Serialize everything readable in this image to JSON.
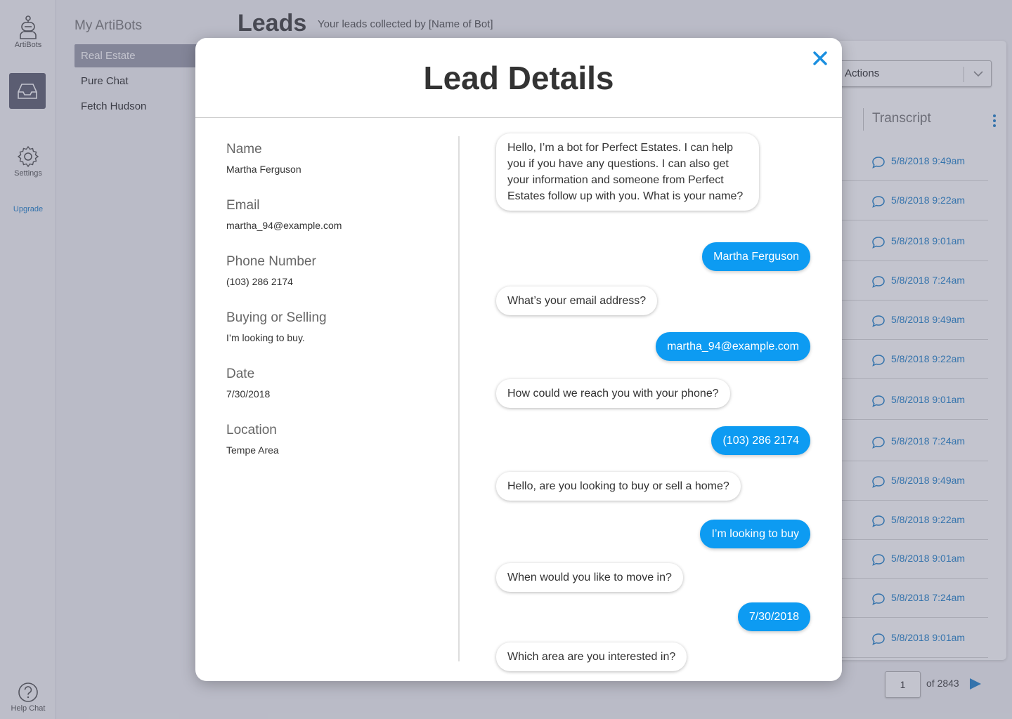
{
  "rail": {
    "artibots_label": "ArtiBots",
    "settings_label": "Settings",
    "upgrade_label": "Upgrade",
    "help_label": "Help Chat"
  },
  "sidebar": {
    "title": "My ArtiBots",
    "items": [
      {
        "label": "Real Estate",
        "active": true
      },
      {
        "label": "Pure Chat",
        "active": false
      },
      {
        "label": "Fetch Hudson",
        "active": false
      }
    ]
  },
  "page": {
    "title": "Leads",
    "subtitle": "Your leads collected by [Name of Bot]"
  },
  "table": {
    "actions_label": "Actions",
    "transcript_header": "Transcript",
    "rows": [
      "5/8/2018 9:49am",
      "5/8/2018 9:22am",
      "5/8/2018 9:01am",
      "5/8/2018 7:24am",
      "5/8/2018 9:49am",
      "5/8/2018 9:22am",
      "5/8/2018 9:01am",
      "5/8/2018 7:24am",
      "5/8/2018 9:49am",
      "5/8/2018 9:22am",
      "5/8/2018 9:01am",
      "5/8/2018 7:24am",
      "5/8/2018 9:01am"
    ]
  },
  "pager": {
    "current": "1",
    "of_label": "of 2843"
  },
  "modal": {
    "title": "Lead Details",
    "fields": [
      {
        "label": "Name",
        "value": "Martha Ferguson"
      },
      {
        "label": "Email",
        "value": "martha_94@example.com"
      },
      {
        "label": "Phone Number",
        "value": "(103) 286 2174"
      },
      {
        "label": "Buying or Selling",
        "value": "I’m looking to buy."
      },
      {
        "label": "Date",
        "value": "7/30/2018"
      },
      {
        "label": "Location",
        "value": "Tempe Area"
      }
    ],
    "chat": [
      {
        "from": "bot",
        "text": "Hello, I’m a bot for Perfect Estates. I can help you if you have any questions. I can also get your information and someone from Perfect Estates follow up with you. What is your name?"
      },
      {
        "from": "user",
        "text": "Martha Ferguson"
      },
      {
        "from": "bot",
        "text": "What’s your email address?"
      },
      {
        "from": "user",
        "text": "martha_94@example.com"
      },
      {
        "from": "bot",
        "text": "How could we reach you with your phone?"
      },
      {
        "from": "user",
        "text": "(103) 286 2174"
      },
      {
        "from": "bot",
        "text": "Hello, are you looking to buy or sell a home?"
      },
      {
        "from": "user",
        "text": "I’m looking to buy"
      },
      {
        "from": "bot",
        "text": "When would you like to move in?"
      },
      {
        "from": "user",
        "text": "7/30/2018"
      },
      {
        "from": "bot",
        "text": "Which area are you interested in?"
      }
    ]
  },
  "colors": {
    "accent": "#0d9bf2",
    "link": "#3a8fd0",
    "sidebar_active": "#a7a8b5"
  }
}
